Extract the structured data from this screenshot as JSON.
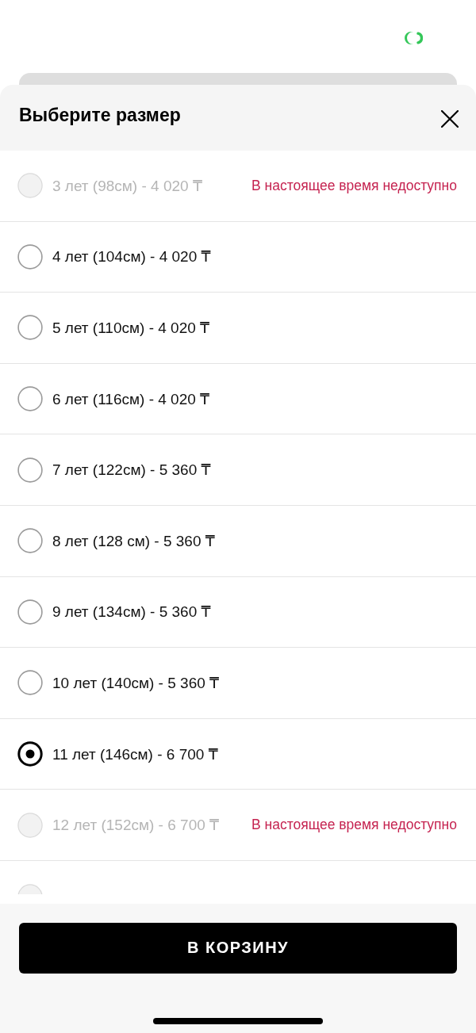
{
  "sheet": {
    "title": "Выберите размер"
  },
  "sizes": [
    {
      "label": "3 лет (98см) - 4 020 ₸",
      "available": false,
      "selected": false,
      "note": "В настоящее время недоступно"
    },
    {
      "label": "4 лет (104см) - 4 020 ₸",
      "available": true,
      "selected": false
    },
    {
      "label": "5 лет (110см) - 4 020 ₸",
      "available": true,
      "selected": false
    },
    {
      "label": "6 лет (116см) - 4 020 ₸",
      "available": true,
      "selected": false
    },
    {
      "label": "7 лет (122см) - 5 360 ₸",
      "available": true,
      "selected": false
    },
    {
      "label": "8 лет (128 см) - 5 360 ₸",
      "available": true,
      "selected": false
    },
    {
      "label": "9 лет (134см) - 5 360 ₸",
      "available": true,
      "selected": false
    },
    {
      "label": "10 лет (140см) - 5 360 ₸",
      "available": true,
      "selected": false
    },
    {
      "label": "11 лет (146см) - 6 700 ₸",
      "available": true,
      "selected": true
    },
    {
      "label": "12 лет (152см) - 6 700 ₸",
      "available": false,
      "selected": false,
      "note": "В настоящее время недоступно"
    },
    {
      "available": false,
      "selected": false
    }
  ],
  "footer": {
    "button": "В КОРЗИНУ"
  }
}
